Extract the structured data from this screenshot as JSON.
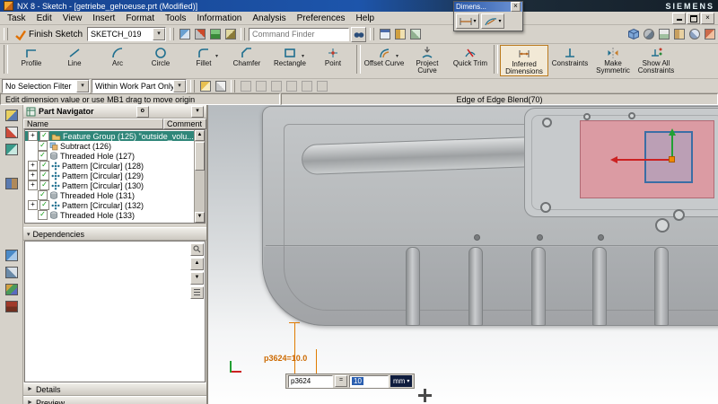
{
  "window": {
    "title": "NX 8 - Sketch - [getriebe_gehoeuse.prt (Modified)]",
    "brand": "SIEMENS"
  },
  "menu": {
    "items": [
      "Task",
      "Edit",
      "View",
      "Insert",
      "Format",
      "Tools",
      "Information",
      "Analysis",
      "Preferences",
      "Help"
    ]
  },
  "toolbar_top": {
    "finish_sketch": "Finish Sketch",
    "sketch_name": "SKETCH_019",
    "command_finder": "Command Finder"
  },
  "sketch_tools": {
    "labels": [
      "Profile",
      "Line",
      "Arc",
      "Circle",
      "Fillet",
      "Chamfer",
      "Rectangle",
      "Point",
      "Offset Curve",
      "Project Curve",
      "Quick Trim",
      "Inferred Dimensions",
      "Constraints",
      "Make Symmetric",
      "Show All Constraints"
    ]
  },
  "selection_bar": {
    "filter": "No Selection Filter",
    "scope": "Within Work Part Only"
  },
  "status_bar": {
    "prompt": "Edit dimension value or use MB1 drag to move origin",
    "status": "Edge of Edge Blend(70)"
  },
  "part_navigator": {
    "title": "Part Navigator",
    "columns": {
      "name": "Name",
      "comment": "Comment"
    },
    "items": [
      {
        "label": "Feature Group (125) \"outside_volu..."
      },
      {
        "label": "Subtract (126)"
      },
      {
        "label": "Threaded Hole (127)"
      },
      {
        "label": "Pattern [Circular] (128)"
      },
      {
        "label": "Pattern [Circular] (129)"
      },
      {
        "label": "Pattern [Circular] (130)"
      },
      {
        "label": "Threaded Hole (131)"
      },
      {
        "label": "Pattern [Circular] (132)"
      },
      {
        "label": "Threaded Hole (133)"
      }
    ]
  },
  "panels": {
    "dependencies": "Dependencies",
    "details": "Details",
    "preview": "Preview"
  },
  "dialog": {
    "title": "Dimens..."
  },
  "viewport": {
    "dimension_label": "p3624=10.0",
    "expression_name": "p3624",
    "expression_value": "10",
    "unit": "mm"
  },
  "icons": {
    "dropdown": "▾",
    "check": "✓",
    "close": "×",
    "plus": "+",
    "equals": "=",
    "up": "▲",
    "down": "▼",
    "collapse": "▾",
    "expand_right": "►"
  }
}
